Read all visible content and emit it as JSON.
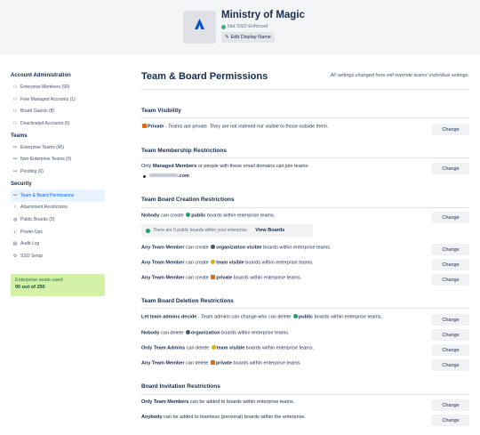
{
  "header": {
    "org_name": "Ministry of Magic",
    "sso_status": "Not SSO Enforced",
    "edit_button": "Edit Display Name",
    "logo_text": "ATLASSIAN"
  },
  "sidebar": {
    "sections": [
      {
        "title": "Account Administration",
        "items": [
          {
            "label": "Enterprise Members (90)",
            "icon": "person-icon"
          },
          {
            "label": "Free Managed Accounts (1)",
            "icon": "person-icon"
          },
          {
            "label": "Board Guests (8)",
            "icon": "person-icon"
          },
          {
            "label": "Deactivated Accounts (6)",
            "icon": "person-icon"
          }
        ]
      },
      {
        "title": "Teams",
        "items": [
          {
            "label": "Enterprise Teams (45)",
            "icon": "team-icon"
          },
          {
            "label": "Non-Enterprise Teams (0)",
            "icon": "team-icon"
          },
          {
            "label": "Pending (0)",
            "icon": "team-icon"
          }
        ]
      },
      {
        "title": "Security",
        "items": [
          {
            "label": "Team & Board Permissions",
            "icon": "team-icon",
            "active": true
          },
          {
            "label": "Attachment Restrictions",
            "icon": "paperclip-icon"
          },
          {
            "label": "Public Boards (0)",
            "icon": "globe-icon"
          },
          {
            "label": "Power-Ups",
            "icon": "rocket-icon"
          },
          {
            "label": "Audit Log",
            "icon": "log-icon"
          },
          {
            "label": "SSO Setup",
            "icon": "gear-icon"
          }
        ]
      }
    ],
    "seats_label": "Enterprise seats used:",
    "seats_value": "90 out of 250"
  },
  "main": {
    "title": "Team & Board Permissions",
    "note": "All settings changed here will override teams' individual settings.",
    "change_label": "Change",
    "visibility": {
      "heading": "Team Visibility",
      "bold": "Private",
      "text": " - Teams are private. They are not indexed nor visible to those outside them."
    },
    "membership": {
      "heading": "Team Membership Restrictions",
      "pre": "Only ",
      "bold": "Managed Members",
      "post": " or people with these email domains can join teams:",
      "domain_suffix": ".com"
    },
    "creation": {
      "heading": "Team Board Creation Restrictions",
      "r1_bold": "Nobody",
      "r1_pre": " can create ",
      "r1_kind": "public",
      "r1_post": " boards within enterprise teams.",
      "info": "There are 0 public boards within your enterprise.",
      "view_boards": "View Boards",
      "r2_bold": "Any Team Member",
      "r2_pre": " can create ",
      "r2_kind": "organization visible",
      "r2_post": " boards within enterprise teams.",
      "r3_bold": "Any Team Member",
      "r3_pre": " can create ",
      "r3_kind": "team visible",
      "r3_post": " boards within enterprise teams.",
      "r4_bold": "Any Team Member",
      "r4_pre": " can create ",
      "r4_kind": "private",
      "r4_post": " boards within enterprise teams."
    },
    "deletion": {
      "heading": "Team Board Deletion Restrictions",
      "r1_bold": "Let team admins decide",
      "r1_pre": " - Team admins can change who can delete ",
      "r1_kind": "public",
      "r1_post": " boards within enterprise teams.",
      "r2_bold": "Nobody",
      "r2_pre": " can delete ",
      "r2_kind": "organization",
      "r2_post": " boards within enterprise teams.",
      "r3_bold": "Only Team Admins",
      "r3_pre": " can delete ",
      "r3_kind": "team visible",
      "r3_post": " boards within enterprise teams.",
      "r4_bold": "Any Team Member",
      "r4_pre": " can delete ",
      "r4_kind": "private",
      "r4_post": " boards within enterprise teams."
    },
    "invitation": {
      "heading": "Board Invitation Restrictions",
      "r1_bold": "Only Team Members",
      "r1_post": " can be added to boards within enterprise teams.",
      "r2_bold": "Anybody",
      "r2_post": " can be added to teamless (personal) boards within the enterprise."
    }
  }
}
